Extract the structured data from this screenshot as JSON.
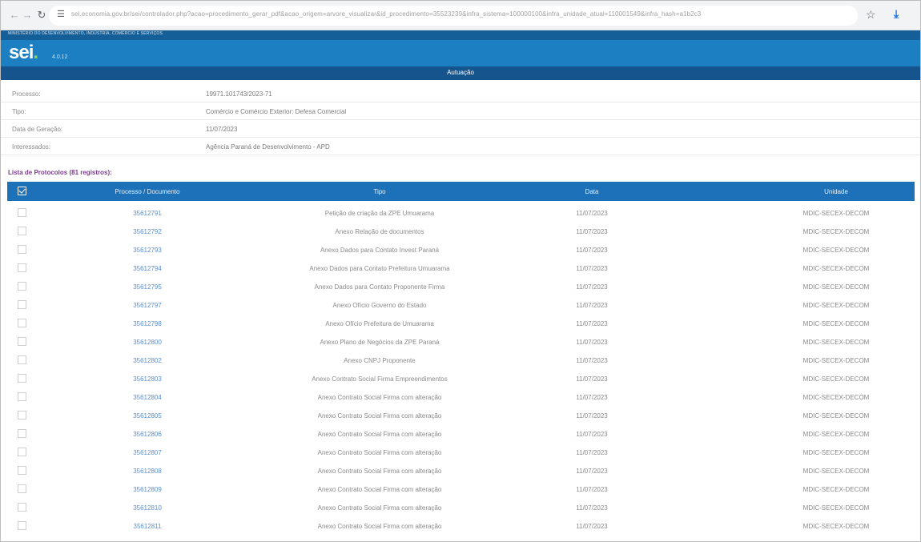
{
  "browser": {
    "url": "sei.economia.gov.br/sei/controlador.php?acao=procedimento_gerar_pdf&acao_origem=arvore_visualizar&id_procedimento=35523239&infra_sistema=100000100&infra_unidade_atual=110001549&infra_hash=a1b2c3"
  },
  "header": {
    "org_line": "MINISTÉRIO DO DESENVOLVIMENTO, INDÚSTRIA, COMÉRCIO E SERVIÇOS",
    "logo_main": "sei",
    "logo_dot": ".",
    "logo_version": "4.0.12",
    "title": "Autuação"
  },
  "info": [
    {
      "label": "Processo:",
      "value": "19971.101743/2023-71"
    },
    {
      "label": "Tipo:",
      "value": "Comércio e Comércio Exterior: Defesa Comercial"
    },
    {
      "label": "Data de Geração:",
      "value": "11/07/2023"
    },
    {
      "label": "Interessados:",
      "value": "Agência Paraná de Desenvolvimento - APD"
    }
  ],
  "list_caption": "Lista de Protocolos (81 registros):",
  "table": {
    "headers": [
      "Processo / Documento",
      "Tipo",
      "Data",
      "Unidade"
    ],
    "rows": [
      {
        "doc": "35612791",
        "tipo": "Petição de criação da ZPE Umuarama",
        "data": "11/07/2023",
        "unidade": "MDIC-SECEX-DECOM"
      },
      {
        "doc": "35612792",
        "tipo": "Anexo Relação de documentos",
        "data": "11/07/2023",
        "unidade": "MDIC-SECEX-DECOM"
      },
      {
        "doc": "35612793",
        "tipo": "Anexo Dados para Contato Invest Paraná",
        "data": "11/07/2023",
        "unidade": "MDIC-SECEX-DECOM"
      },
      {
        "doc": "35612794",
        "tipo": "Anexo Dados para Contato Prefeitura Umuarama",
        "data": "11/07/2023",
        "unidade": "MDIC-SECEX-DECOM"
      },
      {
        "doc": "35612795",
        "tipo": "Anexo Dados para Contato Proponente Firma",
        "data": "11/07/2023",
        "unidade": "MDIC-SECEX-DECOM"
      },
      {
        "doc": "35612797",
        "tipo": "Anexo Ofício Governo do Estado",
        "data": "11/07/2023",
        "unidade": "MDIC-SECEX-DECOM"
      },
      {
        "doc": "35612798",
        "tipo": "Anexo Ofício Prefeitura de Umuarama",
        "data": "11/07/2023",
        "unidade": "MDIC-SECEX-DECOM"
      },
      {
        "doc": "35612800",
        "tipo": "Anexo Plano de Negócios da ZPE Paraná",
        "data": "11/07/2023",
        "unidade": "MDIC-SECEX-DECOM"
      },
      {
        "doc": "35612802",
        "tipo": "Anexo CNPJ Proponente",
        "data": "11/07/2023",
        "unidade": "MDIC-SECEX-DECOM"
      },
      {
        "doc": "35612803",
        "tipo": "Anexo Contrato Social Firma Empreendimentos",
        "data": "11/07/2023",
        "unidade": "MDIC-SECEX-DECOM"
      },
      {
        "doc": "35612804",
        "tipo": "Anexo Contrato Social Firma com alteração",
        "data": "11/07/2023",
        "unidade": "MDIC-SECEX-DECOM"
      },
      {
        "doc": "35612805",
        "tipo": "Anexo Contrato Social Firma com alteração",
        "data": "11/07/2023",
        "unidade": "MDIC-SECEX-DECOM"
      },
      {
        "doc": "35612806",
        "tipo": "Anexo Contrato Social Firma com alteração",
        "data": "11/07/2023",
        "unidade": "MDIC-SECEX-DECOM"
      },
      {
        "doc": "35612807",
        "tipo": "Anexo Contrato Social Firma com alteração",
        "data": "11/07/2023",
        "unidade": "MDIC-SECEX-DECOM"
      },
      {
        "doc": "35612808",
        "tipo": "Anexo Contrato Social Firma com alteração",
        "data": "11/07/2023",
        "unidade": "MDIC-SECEX-DECOM"
      },
      {
        "doc": "35612809",
        "tipo": "Anexo Contrato Social Firma com alteração",
        "data": "11/07/2023",
        "unidade": "MDIC-SECEX-DECOM"
      },
      {
        "doc": "35612810",
        "tipo": "Anexo Contrato Social Firma com alteração",
        "data": "11/07/2023",
        "unidade": "MDIC-SECEX-DECOM"
      },
      {
        "doc": "35612811",
        "tipo": "Anexo Contrato Social Firma com alteração",
        "data": "11/07/2023",
        "unidade": "MDIC-SECEX-DECOM"
      }
    ]
  },
  "colors": {
    "header_dark": "#15548d",
    "header_band": "#1c7fc2",
    "table_header": "#1d71b8",
    "link": "#5b8fcf"
  }
}
